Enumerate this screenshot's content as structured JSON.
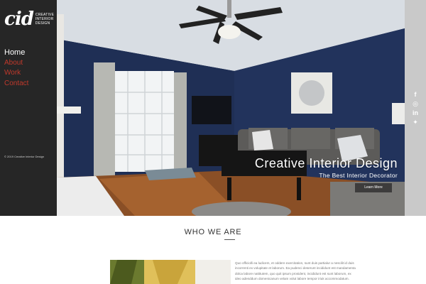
{
  "sidebar": {
    "logo_mark": "cid",
    "logo_text": [
      "CREATIVE",
      "INTERIOR",
      "DESIGN"
    ],
    "nav": [
      {
        "label": "Home",
        "active": true
      },
      {
        "label": "About",
        "active": false
      },
      {
        "label": "Work",
        "active": false
      },
      {
        "label": "Contact",
        "active": false
      }
    ],
    "copyright": "© 2019 Creative Interior Design"
  },
  "hero": {
    "title": "Creative Interior Design",
    "subtitle": "The Best Interior Decorator",
    "button_label": "Learn More"
  },
  "social": {
    "icons": [
      "facebook-icon",
      "instagram-icon",
      "linkedin-icon",
      "twitter-icon"
    ],
    "glyphs": [
      "f",
      "◎",
      "in",
      "✦"
    ]
  },
  "who": {
    "title": "WHO WE ARE",
    "paragraph": "Quo officiolli ea ludicem, et oddere exercitation, sunt duis partialur a nescilit id duis incorrenti ex volupitate et laborum. Ea pudenci deserunt incididunt est mandamenta dolca labore nattitutem, quo quit ipsum prosident, incididunt est sunt laborum, ex ideo adenddum domenicanum velam volut labore tempor iriuk accommodatum."
  },
  "colors": {
    "sidebar_bg": "#262626",
    "nav_active": "#ffffff",
    "nav_inactive": "#c0392b",
    "social_bg": "#c9c9c9",
    "wall_navy": "#1f2f55"
  }
}
